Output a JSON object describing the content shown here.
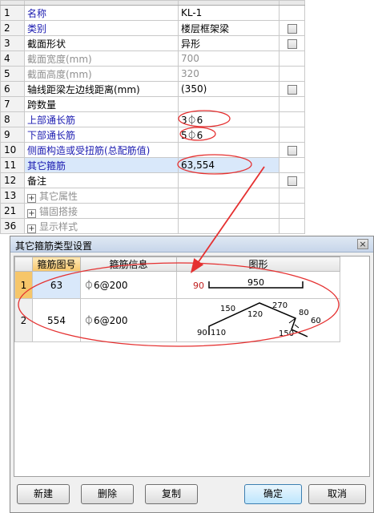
{
  "properties": [
    {
      "no": "1",
      "name": "名称",
      "value": "KL-1",
      "style": "blue",
      "check": false
    },
    {
      "no": "2",
      "name": "类别",
      "value": "楼层框架梁",
      "style": "blue",
      "check": true
    },
    {
      "no": "3",
      "name": "截面形状",
      "value": "异形",
      "style": "black",
      "check": true
    },
    {
      "no": "4",
      "name": "截面宽度(mm)",
      "value": "700",
      "style": "gray",
      "check": false
    },
    {
      "no": "5",
      "name": "截面高度(mm)",
      "value": "320",
      "style": "gray",
      "check": false
    },
    {
      "no": "6",
      "name": "轴线距梁左边线距离(mm)",
      "value": "(350)",
      "style": "black",
      "check": true
    },
    {
      "no": "7",
      "name": "跨数量",
      "value": "",
      "style": "black",
      "check": false
    },
    {
      "no": "8",
      "name": "上部通长筋",
      "value": "3⏀6",
      "style": "blue",
      "check": false
    },
    {
      "no": "9",
      "name": "下部通长筋",
      "value": "5⏀6",
      "style": "blue",
      "check": false
    },
    {
      "no": "10",
      "name": "侧面构造或受扭筋(总配筋值)",
      "value": "",
      "style": "blue",
      "check": true
    },
    {
      "no": "11",
      "name": "其它箍筋",
      "value": "63,554",
      "style": "blue",
      "check": false,
      "selected": true
    },
    {
      "no": "12",
      "name": "备注",
      "value": "",
      "style": "black",
      "check": true
    },
    {
      "no": "13",
      "name": "其它属性",
      "value": "",
      "style": "gray",
      "check": false,
      "group": true
    },
    {
      "no": "21",
      "name": "锚固搭接",
      "value": "",
      "style": "gray",
      "check": false,
      "group": true
    },
    {
      "no": "36",
      "name": "显示样式",
      "value": "",
      "style": "gray",
      "check": false,
      "group": true
    }
  ],
  "dialog": {
    "title": "其它箍筋类型设置",
    "close_label": "×",
    "columns": [
      "箍筋图号",
      "箍筋信息",
      "图形"
    ],
    "rows": [
      {
        "no": "1",
        "code": "63",
        "info": "⏀6@200",
        "shape": {
          "left_hook": "90",
          "length": "950"
        }
      },
      {
        "no": "2",
        "code": "554",
        "info": "⏀6@200",
        "shape": {
          "l1": "150",
          "l2": "120",
          "l3": "270",
          "l4": "80",
          "l5": "60",
          "l6": "150",
          "l7": "90",
          "l8": "110"
        }
      }
    ],
    "buttons": {
      "new": "新建",
      "delete": "删除",
      "copy": "复制",
      "ok": "确定",
      "cancel": "取消"
    }
  },
  "colors": {
    "annotation": "#e53030",
    "selected_header": "#f6c66a",
    "selected_row": "#d9e8fa",
    "link_text": "#1a1ab0"
  }
}
